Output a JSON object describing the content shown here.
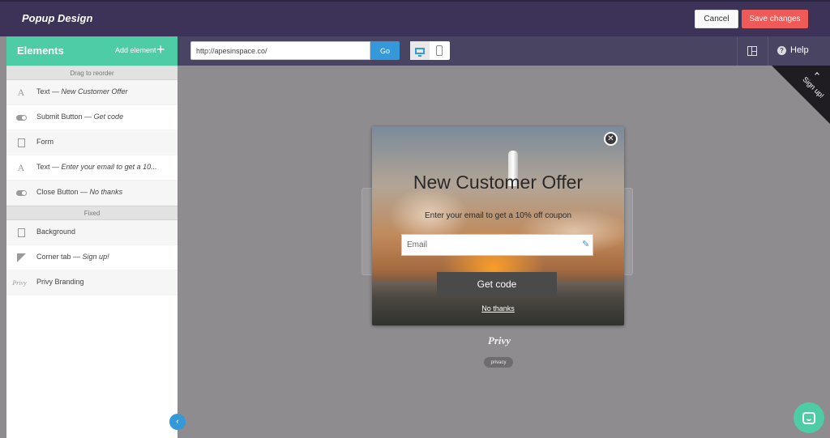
{
  "header": {
    "title": "Popup Design",
    "cancel_label": "Cancel",
    "save_label": "Save changes"
  },
  "sidebar": {
    "title": "Elements",
    "add_label": "Add element",
    "sections": {
      "reorder": "Drag to reorder",
      "fixed": "Fixed"
    },
    "items": [
      {
        "type": "Text",
        "detail": "New Customer Offer",
        "icon": "text-icon"
      },
      {
        "type": "Submit Button",
        "detail": "Get code",
        "icon": "toggle-icon"
      },
      {
        "type": "Form",
        "detail": "",
        "icon": "form-icon"
      },
      {
        "type": "Text",
        "detail": "Enter your email to get a 10...",
        "icon": "text-icon"
      },
      {
        "type": "Close Button",
        "detail": "No thanks",
        "icon": "toggle-icon"
      }
    ],
    "fixed_items": [
      {
        "type": "Background",
        "detail": "",
        "icon": "document-icon"
      },
      {
        "type": "Corner tab",
        "detail": "Sign up!",
        "icon": "corner-tab-icon"
      },
      {
        "type": "Privy Branding",
        "detail": "",
        "icon": "privy-icon"
      }
    ],
    "separator": " — ",
    "privy_icon_text": "Privy"
  },
  "urlbar": {
    "url": "http://apesinspace.co/",
    "go_label": "Go",
    "help_label": "Help"
  },
  "canvas": {
    "corner_tab_label": "Sign up!",
    "popup": {
      "title": "New Customer Offer",
      "subtitle": "Enter your email to get a 10% off coupon",
      "email_placeholder": "Email",
      "submit_label": "Get code",
      "close_label": "No thanks"
    },
    "privy_logo": "Privy",
    "privacy_label": "privacy"
  },
  "colors": {
    "accent": "#4dcca6",
    "primary": "#3598d8",
    "danger": "#ee5a58",
    "header_bg": "#3d3358"
  }
}
